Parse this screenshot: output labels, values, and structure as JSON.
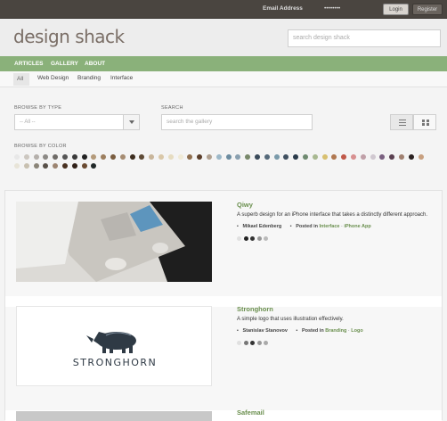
{
  "topbar": {
    "email_label": "Email Address",
    "password_mask": "••••••••",
    "login": "Login",
    "register": "Register"
  },
  "header": {
    "logo": "design shack",
    "search_placeholder": "search design shack"
  },
  "nav": {
    "items": [
      "ARTICLES",
      "GALLERY",
      "ABOUT"
    ]
  },
  "subnav": {
    "items": [
      "All",
      "Web Design",
      "Branding",
      "Interface"
    ]
  },
  "filters": {
    "type_label": "BROWSE BY TYPE",
    "type_value": "-- All --",
    "search_label": "SEARCH",
    "search_placeholder": "search the gallery",
    "color_label": "BROWSE BY COLOR",
    "colors_row1": [
      "#e8e8e8",
      "#ccc7c0",
      "#b5b0ab",
      "#8c8985",
      "#6f6b67",
      "#555",
      "#3a3a3a",
      "#222",
      "#b49a7a",
      "#9c7e5e",
      "#7a5d3f",
      "#a68c72",
      "#3c2c1e",
      "#5e4a36",
      "#c8b59a",
      "#d9c7a8",
      "#e6dcc0",
      "#f0ead6",
      "#8f6f4f",
      "#5a3e2a",
      "#b0a090",
      "#9cb8c8",
      "#6c8ca0",
      "#8aa0b0",
      "#78886a",
      "#3a4a5a",
      "#55697a",
      "#7a9aaa",
      "#405060",
      "#2a3a4a",
      "#6f8a70",
      "#a8b890",
      "#d8c070",
      "#b07850",
      "#c05848",
      "#d89090",
      "#c0a0a8",
      "#d0c8d0",
      "#7a6080",
      "#5a4050",
      "#a08070",
      "#2a2020",
      "#c8a080"
    ],
    "colors_row2": [
      "#e8e4d8",
      "#c8c0b0",
      "#8a8478",
      "#585048",
      "#9c8470",
      "#483020",
      "#302018",
      "#6a4a30",
      "#202828"
    ]
  },
  "items": [
    {
      "title": "Qiwy",
      "desc": "A superb design for an iPhone interface that takes a distinctly different approach.",
      "author": "Mikael Edenberg",
      "posted_label": "Posted in",
      "cat1": "Interface",
      "cat2": "iPhone App",
      "sep": "·",
      "dots": [
        "#e0e0e0",
        "#222",
        "#333",
        "#999",
        "#bbb"
      ]
    },
    {
      "title": "Stronghorn",
      "desc": "A simple logo that uses illustration effectively.",
      "author": "Stanislav Stanovov",
      "posted_label": "Posted in",
      "cat1": "Branding",
      "cat2": "Logo",
      "sep": "·",
      "logo_text": "STRONGHORN",
      "dots": [
        "#e0e0e0",
        "#777",
        "#333",
        "#999",
        "#aaa"
      ]
    },
    {
      "title": "Safemail",
      "desc": "",
      "author": "",
      "posted_label": "",
      "cat1": "",
      "cat2": "",
      "sep": "",
      "dots": []
    }
  ]
}
